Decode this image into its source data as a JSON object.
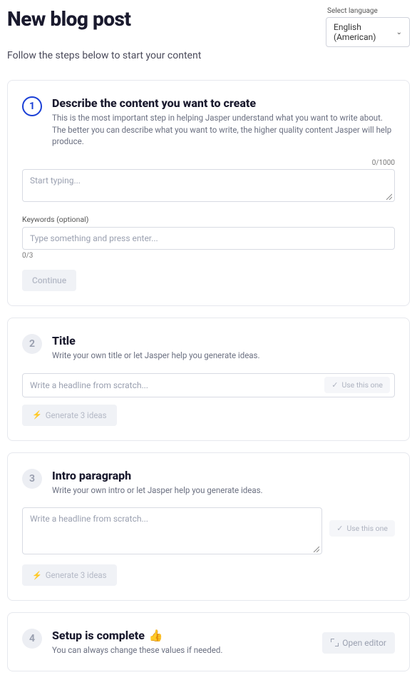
{
  "header": {
    "title": "New blog post",
    "subtitle": "Follow the steps below to start your content"
  },
  "language": {
    "label": "Select language",
    "selected": "English (American)"
  },
  "step1": {
    "number": "1",
    "title": "Describe the content you want to create",
    "desc": "This is the most important step in helping Jasper understand what you want to write about. The better you can describe what you want to write, the higher quality content Jasper will help produce.",
    "counter": "0/1000",
    "placeholder": "Start typing...",
    "keywords_label": "Keywords (optional)",
    "keywords_placeholder": "Type something and press enter...",
    "keywords_counter": "0/3",
    "continue_label": "Continue"
  },
  "step2": {
    "number": "2",
    "title": "Title",
    "desc": "Write your own title or let Jasper help you generate ideas.",
    "input_placeholder": "Write a headline from scratch...",
    "use_label": "Use this one",
    "generate_label": "Generate 3 ideas"
  },
  "step3": {
    "number": "3",
    "title": "Intro paragraph",
    "desc": "Write your own intro or let Jasper help you generate ideas.",
    "input_placeholder": "Write a headline from scratch...",
    "use_label": "Use this one",
    "generate_label": "Generate 3 ideas"
  },
  "step4": {
    "number": "4",
    "title": "Setup is complete",
    "emoji": "👍",
    "desc": "You can always change these values if needed.",
    "open_label": "Open editor"
  }
}
